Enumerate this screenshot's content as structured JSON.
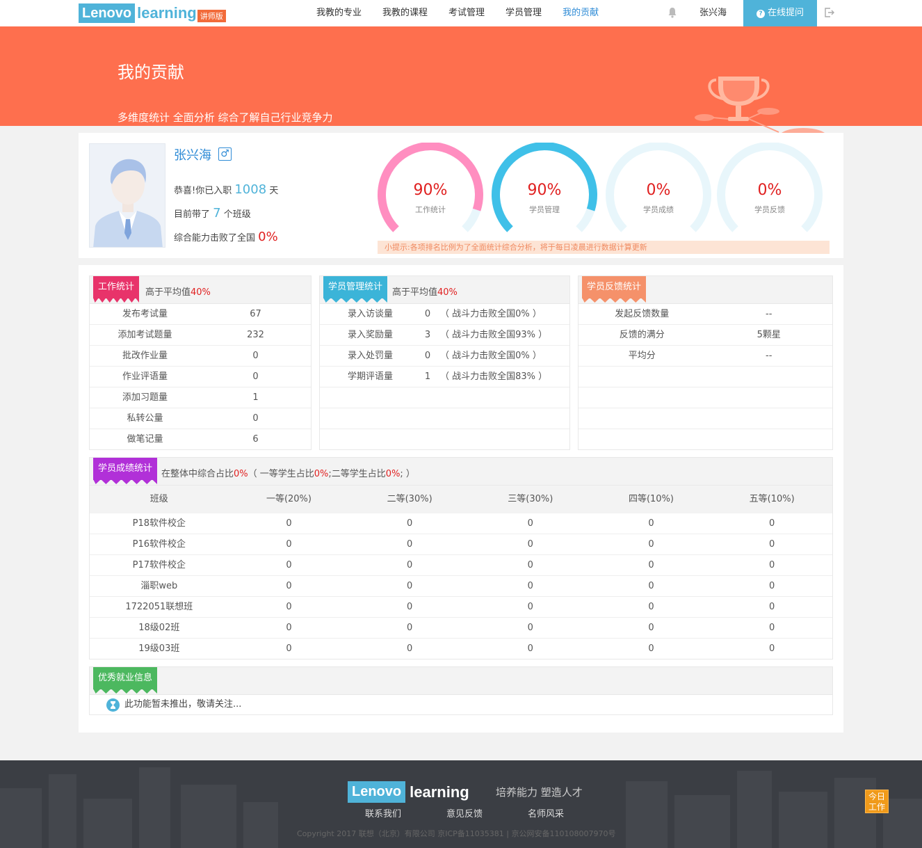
{
  "nav": {
    "logo_brand": "Lenovo",
    "logo_learning": "learning",
    "logo_tag": "讲师版",
    "items": [
      "我教的专业",
      "我教的课程",
      "考试管理",
      "学员管理",
      "我的贡献"
    ],
    "active_index": 4,
    "user": "张兴海",
    "ask_button": "在线提问"
  },
  "banner": {
    "title": "我的贡献",
    "subtitle": "多维度统计 全面分析 综合了解自己行业竞争力"
  },
  "profile": {
    "name": "张兴海",
    "gender_symbol": "♂",
    "days_prefix": "恭喜!你已入职",
    "days": "1008",
    "days_suffix": "天",
    "classes_prefix": "目前带了",
    "classes": "7",
    "classes_suffix": "个班级",
    "beat_prefix": "综合能力击败了全国",
    "beat": "0%"
  },
  "gauges": [
    {
      "value": "90%",
      "label": "工作统计",
      "fraction": 0.9,
      "color": "#ff8ec0"
    },
    {
      "value": "90%",
      "label": "学员管理",
      "fraction": 0.9,
      "color": "#3fc0e8"
    },
    {
      "value": "0%",
      "label": "学员成绩",
      "fraction": 0,
      "color": "#3fc0e8"
    },
    {
      "value": "0%",
      "label": "学员反馈",
      "fraction": 0,
      "color": "#3fc0e8"
    }
  ],
  "tip": "小提示:各项排名比例为了全面统计综合分析，将于每日凌晨进行数据计算更新",
  "work": {
    "badge": "工作统计",
    "above_label": "高于平均值",
    "above_value": "40%",
    "rows": [
      {
        "label": "发布考试量",
        "value": "67"
      },
      {
        "label": "添加考试题量",
        "value": "232"
      },
      {
        "label": "批改作业量",
        "value": "0"
      },
      {
        "label": "作业评语量",
        "value": "0"
      },
      {
        "label": "添加习题量",
        "value": "1"
      },
      {
        "label": "私转公量",
        "value": "0"
      },
      {
        "label": "做笔记量",
        "value": "6"
      }
    ]
  },
  "student_mgmt": {
    "badge": "学员管理统计",
    "above_label": "高于平均值",
    "above_value": "40%",
    "rows": [
      {
        "label": "录入访谈量",
        "value": "0",
        "note": "（ 战斗力击败全国0% ）"
      },
      {
        "label": "录入奖励量",
        "value": "3",
        "note": "（ 战斗力击败全国93% ）"
      },
      {
        "label": "录入处罚量",
        "value": "0",
        "note": "（ 战斗力击败全国0% ）"
      },
      {
        "label": "学期评语量",
        "value": "1",
        "note": "（ 战斗力击败全国83% ）"
      }
    ]
  },
  "feedback": {
    "badge": "学员反馈统计",
    "rows": [
      {
        "label": "发起反馈数量",
        "value": "--"
      },
      {
        "label": "反馈的满分",
        "value": "5颗星"
      },
      {
        "label": "平均分",
        "value": "--"
      }
    ]
  },
  "grades": {
    "badge": "学员成绩统计",
    "summary_a": "在整体中综合占比",
    "summary_b": "0%",
    "summary_c": "（ 一等学生占比",
    "summary_d": "0%",
    "summary_e": ";二等学生占比",
    "summary_f": "0%",
    "summary_g": "; ）",
    "headers": [
      "班级",
      "一等(20%)",
      "二等(30%)",
      "三等(30%)",
      "四等(10%)",
      "五等(10%)"
    ],
    "rows": [
      [
        "P18软件校企",
        "0",
        "0",
        "0",
        "0",
        "0"
      ],
      [
        "P16软件校企",
        "0",
        "0",
        "0",
        "0",
        "0"
      ],
      [
        "P17软件校企",
        "0",
        "0",
        "0",
        "0",
        "0"
      ],
      [
        "淄职web",
        "0",
        "0",
        "0",
        "0",
        "0"
      ],
      [
        "1722051联想班",
        "0",
        "0",
        "0",
        "0",
        "0"
      ],
      [
        "18级02班",
        "0",
        "0",
        "0",
        "0",
        "0"
      ],
      [
        "19级03班",
        "0",
        "0",
        "0",
        "0",
        "0"
      ]
    ]
  },
  "jobs": {
    "badge": "优秀就业信息",
    "note": "此功能暂未推出，敬请关注..."
  },
  "footer": {
    "brand": "Lenovo",
    "learning": "learning",
    "slogan": "培养能力 塑造人才",
    "links": [
      "联系我们",
      "意见反馈",
      "名师风采"
    ],
    "copyright": "Copyright 2017 联想（北京）有限公司 京ICP备11035381 | 京公网安备110108007970号",
    "today_button": "今日工作"
  },
  "colors": {
    "banner": "#fe6f4e",
    "accent": "#4fb3d9",
    "badge_work": "#e8336a",
    "badge_student_mgmt": "#3bb4d8",
    "badge_feedback": "#f5916a",
    "badge_grades": "#b130d8",
    "badge_jobs": "#4cb85f"
  }
}
